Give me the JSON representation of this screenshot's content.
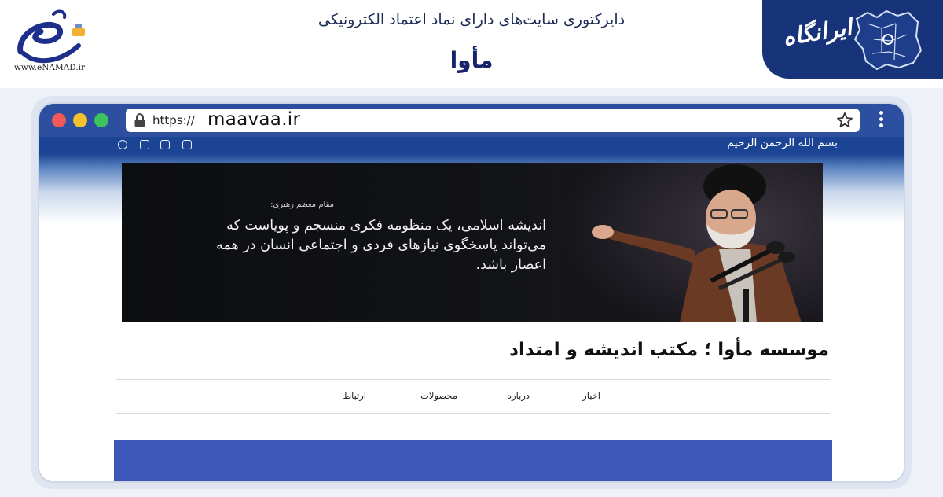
{
  "banner": {
    "enamad_url": "www.eNAMAD.ir",
    "directory_title": "دایرکتوری سایت‌های دارای نماد اعتماد الکترونیکی",
    "site_title": "مأوا",
    "badge_text": "ایرانگاه",
    "badge_color": "#17337a"
  },
  "browser": {
    "url_prefix": "https://",
    "url_domain": "maavaa.ir",
    "chrome_color": "#2c4fa0"
  },
  "site": {
    "basmala": "بسم الله الرحمن الرحیم",
    "social_icons": [
      "wordpress-icon",
      "windows-icon",
      "eitaa-icon",
      "instagram-icon"
    ],
    "hero": {
      "caption": "مقام معظم رهبری:",
      "quote": "اندیشه اسلامی، یک منظومه فکری منسجم و پویاست که می‌تواند پاسخگوی نیازهای فردی و اجتماعی انسان در همه اعصار باشد."
    },
    "heading": "موسسه مأوا ؛ مکتب اندیشه و امتداد",
    "nav": {
      "news": "اخبار",
      "about": "درباره",
      "products": "محصولات",
      "contact": "ارتباط"
    },
    "panel_color": "#3d58b8"
  }
}
